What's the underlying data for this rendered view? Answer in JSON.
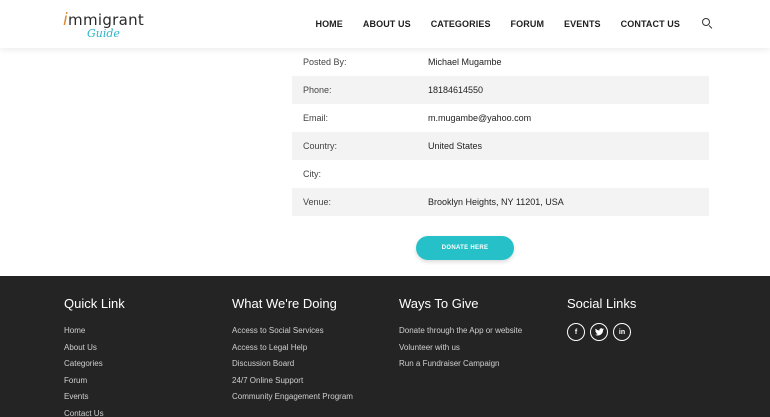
{
  "header": {
    "logo_top_i": "i",
    "logo_top_rest": "mmigrant",
    "logo_bottom": "Guide",
    "nav": [
      "HOME",
      "ABOUT US",
      "CATEGORIES",
      "FORUM",
      "EVENTS",
      "CONTACT US"
    ]
  },
  "details": [
    {
      "label": "Posted By:",
      "value": "Michael Mugambe"
    },
    {
      "label": "Phone:",
      "value": "18184614550"
    },
    {
      "label": "Email:",
      "value": "m.mugambe@yahoo.com"
    },
    {
      "label": "Country:",
      "value": "United States"
    },
    {
      "label": "City:",
      "value": ""
    },
    {
      "label": "Venue:",
      "value": "Brooklyn Heights, NY 11201, USA"
    }
  ],
  "donate_label": "DONATE HERE",
  "footer": {
    "quick_link": {
      "title": "Quick Link",
      "items": [
        "Home",
        "About Us",
        "Categories",
        "Forum",
        "Events",
        "Contact Us"
      ]
    },
    "doing": {
      "title": "What We're Doing",
      "items": [
        "Access to Social Services",
        "Access to Legal Help",
        "Discussion Board",
        "24/7 Online Support",
        "Community Engagement Program"
      ]
    },
    "give": {
      "title": "Ways To Give",
      "items": [
        "Donate through the App or website",
        "Volunteer with us",
        "Run a Fundraiser Campaign"
      ]
    },
    "social": {
      "title": "Social Links",
      "icons": [
        {
          "name": "facebook-icon",
          "glyph": "f"
        },
        {
          "name": "twitter-icon",
          "glyph": "🐦"
        },
        {
          "name": "linkedin-icon",
          "glyph": "in"
        }
      ]
    }
  }
}
